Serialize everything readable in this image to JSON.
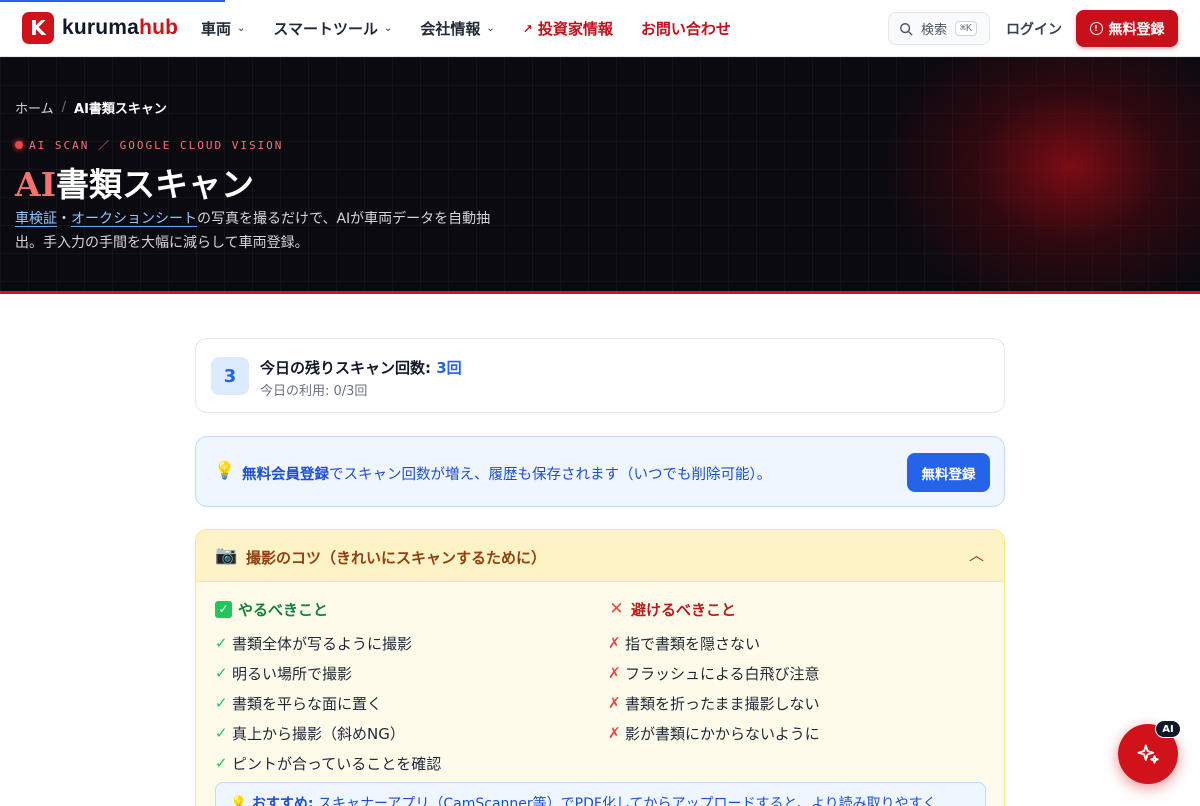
{
  "header": {
    "logo_mark": "K",
    "logo_text_main": "kuruma",
    "logo_text_accent": "hub",
    "nav": [
      {
        "label": "車両"
      },
      {
        "label": "スマートツール"
      },
      {
        "label": "会社情報"
      },
      {
        "label": "投資家情報"
      },
      {
        "label": "お問い合わせ"
      }
    ],
    "search_label": "検索",
    "search_shortcut": "⌘K",
    "login_label": "ログイン",
    "register_label": "無料登録"
  },
  "hero": {
    "breadcrumb_home": "ホーム",
    "breadcrumb_sep": "/",
    "breadcrumb_current": "AI書類スキャン",
    "eyebrow": "AI SCAN ／ GOOGLE CLOUD VISION",
    "title_accent": "AI",
    "title_rest": "書類スキャン",
    "desc_link1": "車検証",
    "desc_sep": "・",
    "desc_link2": "オークションシート",
    "desc_rest": "の写真を撮るだけで、AIが車両データを自動抽出。手入力の手間を大幅に減らして車両登録。"
  },
  "quota": {
    "count": "3",
    "title_prefix": "今日の残りスキャン回数:",
    "title_value": "3回",
    "subtitle": "今日の利用: 0/3回"
  },
  "promo": {
    "bold": "無料会員登録",
    "text": "でスキャン回数が増え、履歴も保存されます（いつでも削除可能）。",
    "button": "無料登録"
  },
  "tips": {
    "title": "撮影のコツ（きれいにスキャンするために）",
    "do_title": "やるべきこと",
    "do_items": [
      "書類全体が写るように撮影",
      "明るい場所で撮影",
      "書類を平らな面に置く",
      "真上から撮影（斜めNG）",
      "ピントが合っていることを確認"
    ],
    "dont_title": "避けるべきこと",
    "dont_items": [
      "指で書類を隠さない",
      "フラッシュによる白飛び注意",
      "書類を折ったまま撮影しない",
      "影が書類にかからないように"
    ],
    "recommend_bold": "おすすめ:",
    "recommend_text": "スキャナーアプリ（CamScanner等）でPDF化してからアップロードすると、より読み取りやすく"
  },
  "fab": {
    "badge": "AI"
  },
  "colors": {
    "brand_red": "#d0121b",
    "accent_blue": "#2563eb",
    "hero_bg": "#0b0a10"
  }
}
